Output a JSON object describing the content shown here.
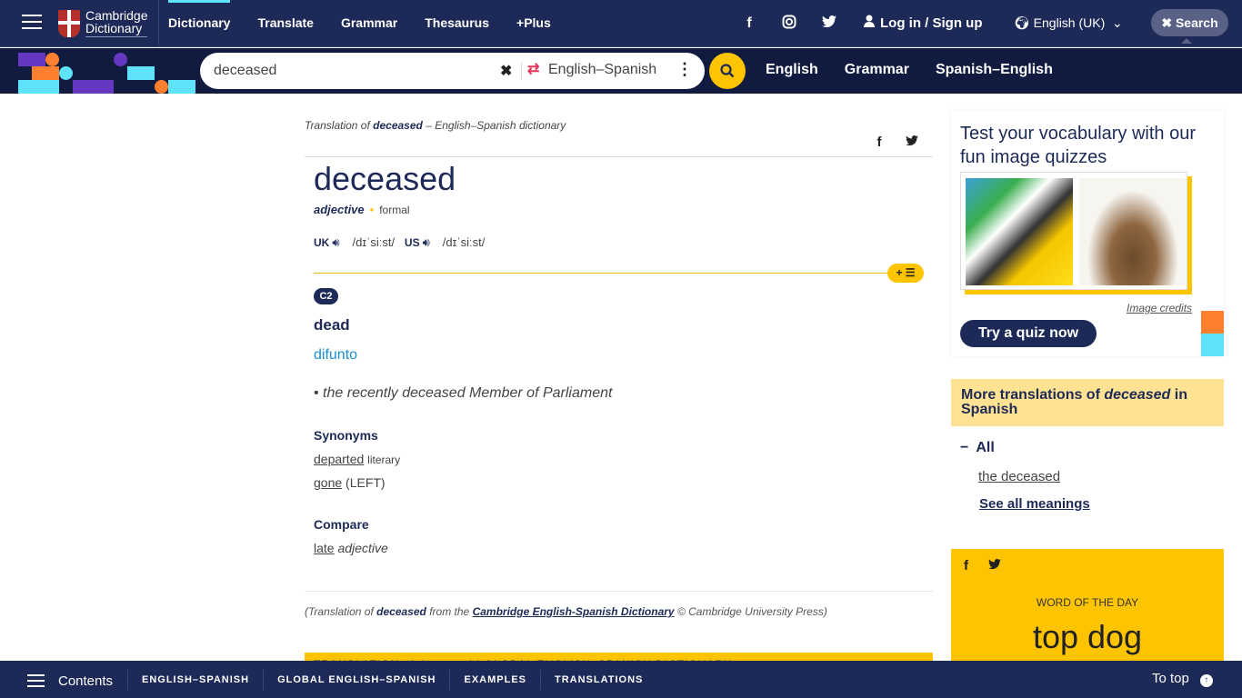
{
  "header": {
    "logo_line1": "Cambridge",
    "logo_line2": "Dictionary",
    "nav": [
      "Dictionary",
      "Translate",
      "Grammar",
      "Thesaurus",
      "+Plus"
    ],
    "social": {
      "facebook": "f",
      "instagram": "◎",
      "twitter": "🐦"
    },
    "login_label": "Log in / Sign up",
    "language_label": "English (UK)",
    "search_toggle_label": "Search"
  },
  "searchbar": {
    "query": "deceased",
    "dictionary": "English–Spanish",
    "sub_nav": [
      "English",
      "Grammar",
      "Spanish–English"
    ]
  },
  "entry": {
    "breadcrumb_prefix": "Translation of",
    "breadcrumb_word": "deceased",
    "breadcrumb_suffix": "– English–Spanish dictionary",
    "headword": "deceased",
    "pos": "adjective",
    "register": "formal",
    "pron_uk_label": "UK",
    "pron_uk": "/dɪˈsiːst/",
    "pron_us_label": "US",
    "pron_us": "/dɪˈsiːst/",
    "level": "C2",
    "sense": "dead",
    "translation": "difunto",
    "example": "the recently deceased Member of Parliament",
    "synonyms_heading": "Synonyms",
    "synonyms": [
      {
        "word": "departed",
        "note": "literary"
      },
      {
        "word": "gone",
        "note": "(LEFT)"
      }
    ],
    "compare_heading": "Compare",
    "compare": {
      "word": "late",
      "note": "adjective"
    },
    "credit_prefix": "(Translation of",
    "credit_word": "deceased",
    "credit_mid": "from the",
    "credit_link": "Cambridge English-Spanish Dictionary",
    "credit_suffix": "© Cambridge University Press)",
    "next_section": "TRANSLATION of deceased | GLOBAL ENGLISH–SPANISH DICTIONARY"
  },
  "sidebar": {
    "quiz_title": "Test your vocabulary with our fun image quizzes",
    "image_credits": "Image credits",
    "quiz_button": "Try a quiz now",
    "more_prefix": "More translations of",
    "more_word": "deceased",
    "more_suffix": "in Spanish",
    "all_label": "All",
    "more_items": [
      "the deceased"
    ],
    "see_all": "See all meanings",
    "wotd_label": "WORD OF THE DAY",
    "wotd_word": "top dog"
  },
  "bottombar": {
    "contents_label": "Contents",
    "tabs": [
      "ENGLISH–SPANISH",
      "GLOBAL ENGLISH–SPANISH",
      "EXAMPLES",
      "TRANSLATIONS"
    ],
    "to_top_label": "To top"
  },
  "colors": {
    "navy": "#1d2a57",
    "yellow": "#fec400",
    "cyan": "#5ee3fa",
    "orange": "#fe7f2d",
    "purple": "#6438c0"
  }
}
